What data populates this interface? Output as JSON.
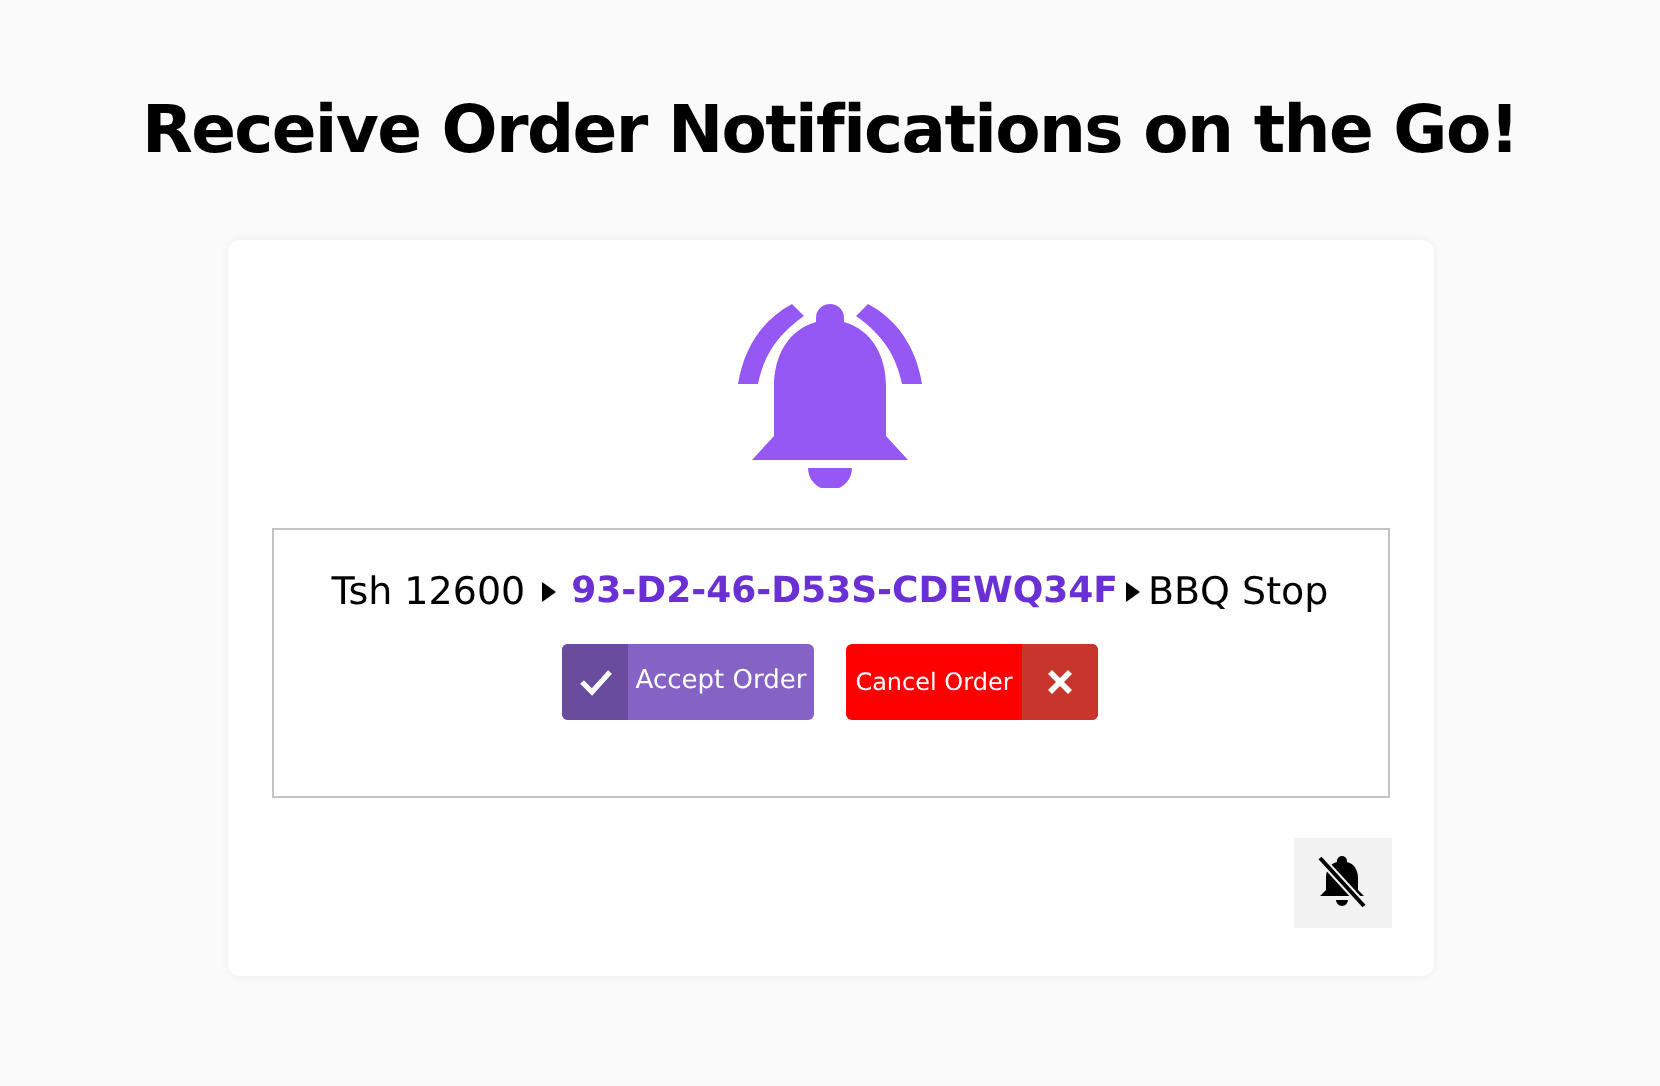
{
  "title": "Receive Order Notifications on the Go!",
  "order": {
    "amount": "Tsh 12600",
    "order_id": "93-D2-46-D53S-CDEWQ34F",
    "restaurant": "BBQ Stop"
  },
  "buttons": [
    {
      "kind": "accept",
      "label": "Accept Order"
    },
    {
      "kind": "cancel",
      "label": "Cancel Order"
    }
  ]
}
